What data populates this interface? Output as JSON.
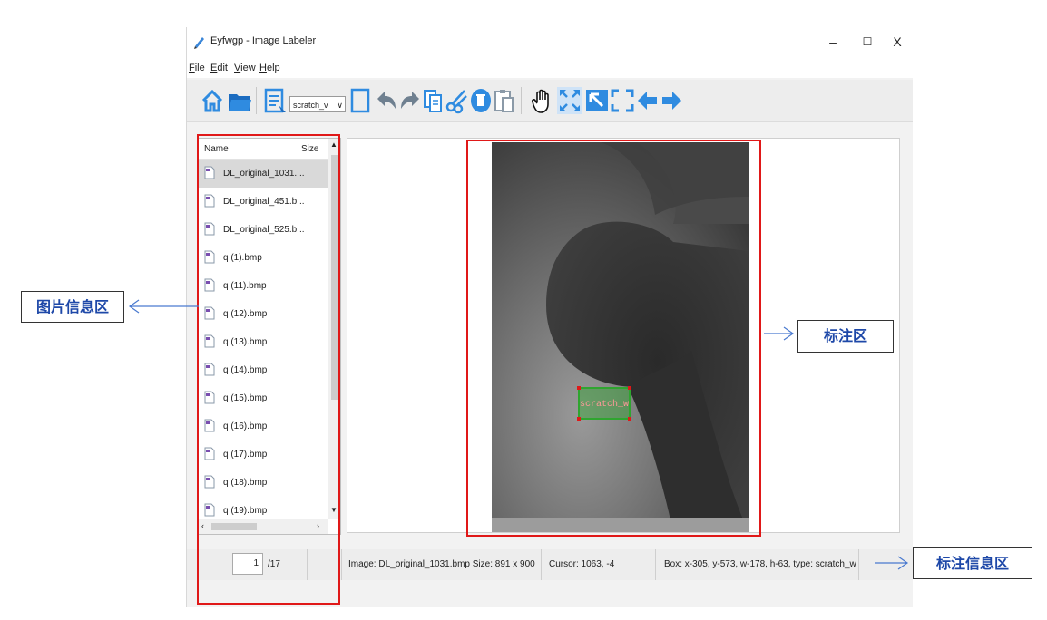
{
  "window": {
    "title": "Eyfwgp - Image Labeler",
    "controls": {
      "minimize": "–",
      "maximize": "☐",
      "close": "X"
    }
  },
  "menu": [
    {
      "key": "F",
      "rest": "ile"
    },
    {
      "key": "E",
      "rest": "dit"
    },
    {
      "key": "V",
      "rest": "iew"
    },
    {
      "key": "H",
      "rest": "elp"
    }
  ],
  "toolbar": {
    "label_select_value": "scratch_v",
    "icons": [
      "home-icon",
      "open-folder-icon",
      "open-list-icon",
      "label-select",
      "rectangle-icon",
      "undo-icon",
      "redo-icon",
      "copy-icon",
      "cut-icon",
      "delete-icon",
      "paste-icon",
      "pan-hand-icon",
      "fit-window-icon",
      "select-arrow-icon",
      "fullscreen-icon",
      "previous-icon",
      "next-icon"
    ],
    "colors": {
      "accent": "#2f8be0",
      "accent_dark": "#1c6cc0",
      "gray": "#6f8090"
    }
  },
  "file_list": {
    "columns": {
      "name": "Name",
      "size": "Size"
    },
    "files": [
      {
        "name": "DL_original_1031....",
        "selected": true
      },
      {
        "name": "DL_original_451.b...",
        "selected": false
      },
      {
        "name": "DL_original_525.b...",
        "selected": false
      },
      {
        "name": "q (1).bmp",
        "selected": false
      },
      {
        "name": "q (11).bmp",
        "selected": false
      },
      {
        "name": "q (12).bmp",
        "selected": false
      },
      {
        "name": "q (13).bmp",
        "selected": false
      },
      {
        "name": "q (14).bmp",
        "selected": false
      },
      {
        "name": "q (15).bmp",
        "selected": false
      },
      {
        "name": "q (16).bmp",
        "selected": false
      },
      {
        "name": "q (17).bmp",
        "selected": false
      },
      {
        "name": "q (18).bmp",
        "selected": false
      },
      {
        "name": "q (19).bmp",
        "selected": false
      }
    ]
  },
  "canvas": {
    "annotation_label": "scratch_w",
    "box_color": "#2fa52f"
  },
  "status": {
    "page_current": "1",
    "page_total": "/17",
    "image_info": "Image: DL_original_1031.bmp Size: 891 x 900",
    "cursor_info": "Cursor: 1063, -4",
    "box_info": "Box: x-305, y-573, w-178, h-63, type: scratch_w"
  },
  "callouts": {
    "file_info_area": "图片信息区",
    "label_area": "标注区",
    "label_info_area": "标注信息区"
  },
  "colors": {
    "highlight_red": "#e01818",
    "callout_text": "#1e48a8"
  }
}
